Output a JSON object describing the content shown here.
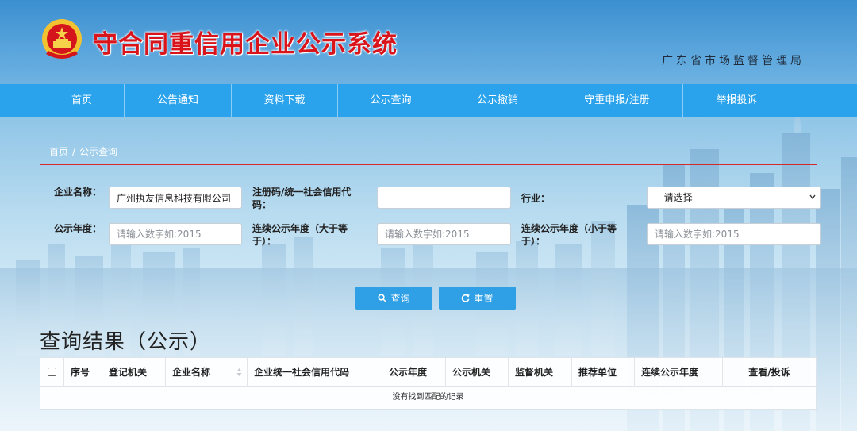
{
  "header": {
    "site_title": "守合同重信用企业公示系统",
    "authority": "广东省市场监督管理局",
    "emblem_icon": "national-emblem-icon"
  },
  "nav": {
    "items": [
      {
        "label": "首页"
      },
      {
        "label": "公告通知"
      },
      {
        "label": "资料下载"
      },
      {
        "label": "公示查询"
      },
      {
        "label": "公示撤销"
      },
      {
        "label": "守重申报/注册"
      },
      {
        "label": "举报投诉"
      }
    ]
  },
  "breadcrumb": {
    "home": "首页",
    "separator": "/",
    "current": "公示查询"
  },
  "form": {
    "company_name": {
      "label": "企业名称：",
      "value": "广州执友信息科技有限公司"
    },
    "credit_code": {
      "label": "注册码/统一社会信用代码：",
      "value": ""
    },
    "industry": {
      "label": "行业：",
      "selected": "--请选择--"
    },
    "year": {
      "label": "公示年度：",
      "placeholder": "请输入数字如:2015"
    },
    "consecutive_min": {
      "label": "连续公示年度（大于等于）：",
      "placeholder": "请输入数字如:2015"
    },
    "consecutive_max": {
      "label": "连续公示年度（小于等于）：",
      "placeholder": "请输入数字如:2015"
    }
  },
  "buttons": {
    "search": {
      "label": "查询",
      "icon": "search-icon"
    },
    "reset": {
      "label": "重置",
      "icon": "refresh-icon"
    }
  },
  "results": {
    "title": "查询结果（公示）",
    "columns": [
      "序号",
      "登记机关",
      "企业名称",
      "企业统一社会信用代码",
      "公示年度",
      "公示机关",
      "监督机关",
      "推荐单位",
      "连续公示年度",
      "查看/投诉"
    ],
    "empty_message": "没有找到匹配的记录"
  },
  "colors": {
    "title_red": "#d9141b",
    "nav_blue": "#2aa3ec",
    "button_blue": "#2f9fe6",
    "divider_red": "#d42a2a"
  }
}
